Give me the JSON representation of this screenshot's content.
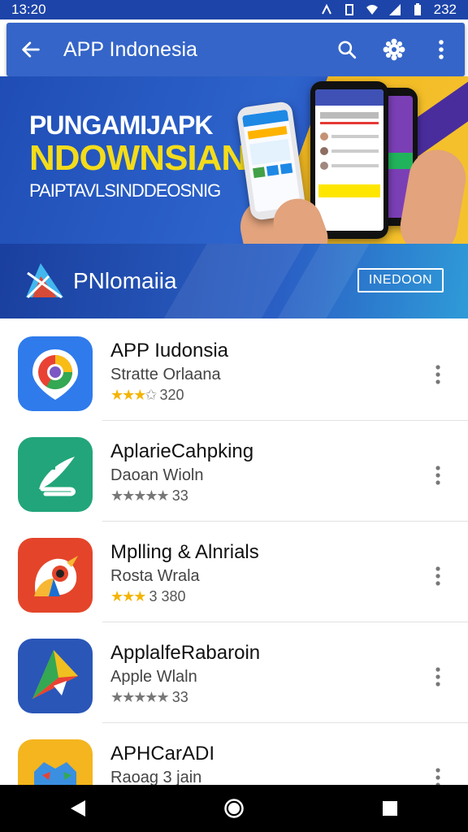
{
  "status_bar": {
    "time": "13:20",
    "right_text": "232"
  },
  "app_bar": {
    "title": "APP Indonesia",
    "icons": [
      "back-arrow-icon",
      "search-icon",
      "gear-icon",
      "more-vert-icon"
    ]
  },
  "hero": {
    "line1": "PUNGAMIJAPK",
    "line2": "NDOWNSIAN",
    "line3": "PAIPTAVLSINDDEOSNIG"
  },
  "brand_strip": {
    "name": "PNlomaiia",
    "button_label": "INEDOON"
  },
  "apps": [
    {
      "title": "APP Iudonsia",
      "subtitle": "Stratte Orlaana",
      "stars_filled": "★★★",
      "stars_empty": "✩",
      "rating_text": "320",
      "icon": "chrome-like-icon",
      "colors": [
        "#2f7bec",
        "#ffffff"
      ]
    },
    {
      "title": "AplarieCahpking",
      "subtitle": "Daoan Wioln",
      "stars_filled": "★★★★★",
      "stars_empty": "",
      "rating_text": "33",
      "icon": "feather-icon",
      "colors": [
        "#22a57a",
        "#ffffff"
      ]
    },
    {
      "title": "Mplling & Alnrials",
      "subtitle": "Rosta Wrala",
      "stars_filled": "★★★",
      "stars_empty": "",
      "rating_text": "3 380",
      "icon": "parrot-icon",
      "colors": [
        "#e4452a",
        "#ffffff"
      ]
    },
    {
      "title": "ApplalfeRabaroin",
      "subtitle": "Apple Wlaln",
      "stars_filled": "★★★★★",
      "stars_empty": "",
      "rating_text": "33",
      "icon": "triangle-play-icon",
      "colors": [
        "#2a56b8",
        "#ffffff"
      ]
    },
    {
      "title": "APHCarADI",
      "subtitle": "Raoag 3 jain",
      "stars_filled": "",
      "stars_empty": "",
      "rating_text": "",
      "icon": "cat-face-icon",
      "colors": [
        "#f4b51e",
        "#3a8fe0"
      ]
    }
  ],
  "nav_bar": {
    "icons": [
      "nav-back-icon",
      "nav-home-icon",
      "nav-recents-icon"
    ]
  }
}
